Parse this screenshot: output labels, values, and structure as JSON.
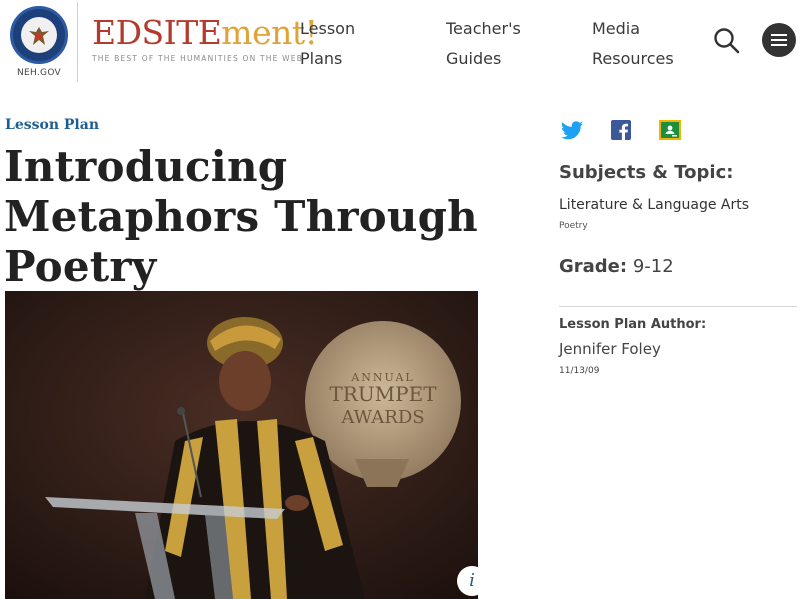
{
  "header": {
    "neh_label": "NEH.GOV",
    "brand_main": "EDSITE",
    "brand_accent": "ment!",
    "brand_tagline": "THE BEST OF THE HUMANITIES ON THE WEB",
    "nav": [
      {
        "label_line1": "Lesson",
        "label_line2": "Plans"
      },
      {
        "label_line1": "Teacher's",
        "label_line2": "Guides"
      },
      {
        "label_line1": "Media",
        "label_line2": "Resources"
      }
    ],
    "search_icon": "search-icon",
    "menu_icon": "hamburger-menu-icon"
  },
  "main": {
    "kicker": "Lesson Plan",
    "title": "Introducing Metaphors Through Poetry",
    "hero_image": {
      "info_badge": "i",
      "sign_line1": "ANNUAL",
      "sign_line2": "TRUMPET",
      "sign_line3": "AWARDS"
    }
  },
  "sidebar": {
    "share": [
      "twitter-icon",
      "facebook-icon",
      "google-classroom-icon"
    ],
    "subjects_heading": "Subjects & Topic:",
    "subject": "Literature & Language Arts",
    "topic": "Poetry",
    "grade_label": "Grade:",
    "grade_value": "9-12",
    "author_label": "Lesson Plan Author:",
    "author_name": "Jennifer Foley",
    "date": "11/13/09"
  },
  "colors": {
    "brand_red": "#b53a2e",
    "brand_gold": "#e0a33a",
    "link_blue": "#1c5e92",
    "twitter": "#1da1f2",
    "facebook": "#3b5998",
    "classroom": "#1e8e3e"
  }
}
